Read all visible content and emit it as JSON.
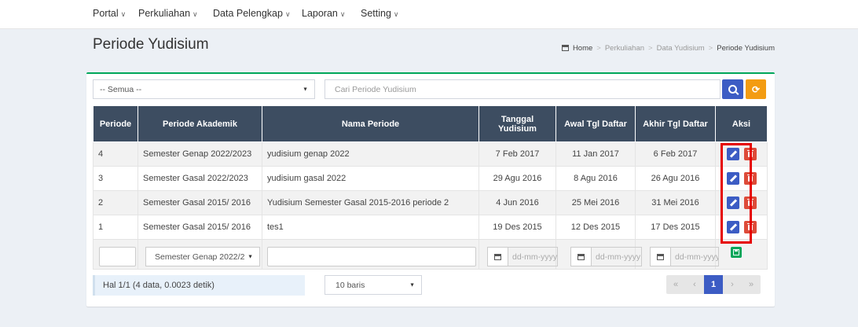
{
  "nav": {
    "items": [
      {
        "label": "Portal"
      },
      {
        "label": "Perkuliahan"
      },
      {
        "label": "Data Pelengkap"
      },
      {
        "label": "Laporan"
      },
      {
        "label": "Setting"
      }
    ]
  },
  "page": {
    "title": "Periode Yudisium",
    "breadcrumb": [
      "Home",
      "Perkuliahan",
      "Data Yudisium",
      "Periode Yudisium"
    ]
  },
  "filter": {
    "select_value": "-- Semua --",
    "search_placeholder": "Cari Periode Yudisium"
  },
  "table": {
    "headers": [
      "Periode",
      "Periode Akademik",
      "Nama Periode",
      "Tanggal Yudisium",
      "Awal Tgl Daftar",
      "Akhir Tgl Daftar",
      "Aksi"
    ],
    "rows": [
      {
        "periode": "4",
        "akademik": "Semester Genap 2022/2023",
        "nama": "yudisium genap 2022",
        "tanggal": "7 Feb 2017",
        "awal": "11 Jan 2017",
        "akhir": "6 Feb 2017"
      },
      {
        "periode": "3",
        "akademik": "Semester Gasal 2022/2023",
        "nama": "yudisium gasal 2022",
        "tanggal": "29 Agu 2016",
        "awal": "8 Agu 2016",
        "akhir": "26 Agu 2016"
      },
      {
        "periode": "2",
        "akademik": "Semester Gasal 2015/ 2016",
        "nama": "Yudisium Semester Gasal 2015-2016 periode 2",
        "tanggal": "4 Jun 2016",
        "awal": "25 Mei 2016",
        "akhir": "31 Mei 2016"
      },
      {
        "periode": "1",
        "akademik": "Semester Gasal 2015/ 2016",
        "nama": "tes1",
        "tanggal": "19 Des 2015",
        "awal": "12 Des 2015",
        "akhir": "17 Des 2015"
      }
    ],
    "new_row": {
      "akademik_select": "Semester Genap 2022/2",
      "date_placeholder": "dd-mm-yyyy"
    }
  },
  "footer": {
    "info": "Hal 1/1 (4 data, 0.0023 detik)",
    "page_size": "10 baris",
    "pager": {
      "first": "«",
      "prev": "‹",
      "current": "1",
      "next": "›",
      "last": "»"
    }
  },
  "colors": {
    "header_bg": "#3d4d61",
    "primary": "#3c5cc4",
    "danger": "#dd4b39",
    "warning": "#f39c12",
    "success": "#00a65a",
    "highlight": "#e60000"
  }
}
